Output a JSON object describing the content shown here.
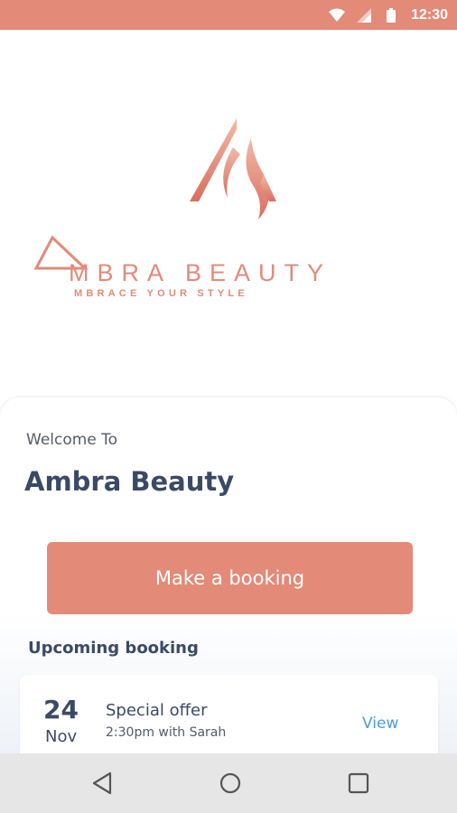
{
  "status_bar": {
    "time": "12:30",
    "icons": [
      "wifi-icon",
      "signal-icon",
      "battery-icon"
    ],
    "background": "#e38a78"
  },
  "logo": {
    "wordmark": "MBRA BEAUTY",
    "tagline": "MBRACE YOUR STYLE"
  },
  "welcome": {
    "label": "Welcome To",
    "title": "Ambra Beauty"
  },
  "actions": {
    "booking_button_label": "Make a booking"
  },
  "upcoming": {
    "heading": "Upcoming booking",
    "items": [
      {
        "day": "24",
        "month": "Nov",
        "title": "Special offer",
        "subtitle": "2:30pm with Sarah",
        "action": "View"
      }
    ]
  },
  "nav_bar": {
    "buttons": [
      "back-icon",
      "home-icon",
      "recents-icon"
    ]
  },
  "colors": {
    "accent": "#e38a78",
    "heading": "#3a4a66",
    "link": "#4a9be0"
  }
}
